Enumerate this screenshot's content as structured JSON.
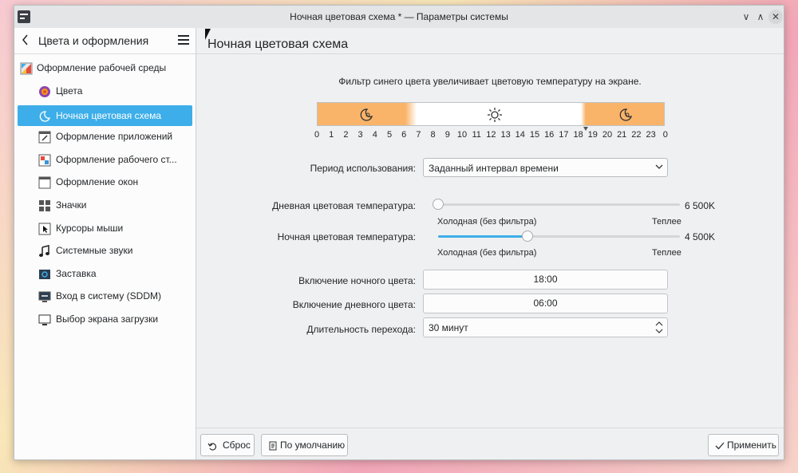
{
  "window": {
    "title": "Ночная цветовая схема * — Параметры системы",
    "controls": [
      "∨",
      "∧",
      "✕"
    ]
  },
  "sidebar": {
    "back_icon": "chevron-left-icon",
    "title": "Цвета и оформления",
    "menu_icon": "hamburger-icon",
    "top_item": {
      "label": "Оформление рабочей среды",
      "icon": "appearance-icon"
    },
    "items": [
      {
        "label": "Цвета",
        "icon": "colors-icon"
      },
      {
        "label": "Ночная цветовая схема",
        "icon": "night-color-icon",
        "active": true
      },
      {
        "label": "Оформление приложений",
        "icon": "app-style-icon"
      },
      {
        "label": "Оформление рабочего ст...",
        "icon": "plasma-style-icon"
      },
      {
        "label": "Оформление окон",
        "icon": "window-decoration-icon"
      },
      {
        "label": "Значки",
        "icon": "icons-icon"
      },
      {
        "label": "Курсоры мыши",
        "icon": "cursor-icon"
      },
      {
        "label": "Системные звуки",
        "icon": "music-note-icon"
      },
      {
        "label": "Заставка",
        "icon": "splash-screen-icon"
      },
      {
        "label": "Вход в систему (SDDM)",
        "icon": "login-screen-icon"
      },
      {
        "label": "Выбор экрана загрузки",
        "icon": "boot-screen-icon"
      }
    ]
  },
  "content": {
    "page_title": "Ночная цветовая схема",
    "description": "Фильтр синего цвета увеличивает цветовую температуру на экране.",
    "timeline": {
      "hours": [
        "0",
        "1",
        "2",
        "3",
        "4",
        "5",
        "6",
        "7",
        "8",
        "9",
        "10",
        "11",
        "12",
        "13",
        "14",
        "15",
        "16",
        "17",
        "18",
        "19",
        "20",
        "21",
        "22",
        "23",
        "0"
      ],
      "night_color": "#f9b46a",
      "day_color": "#ffffff",
      "current_hour": 17.6
    },
    "usage_period": {
      "label": "Период использования:",
      "value": "Заданный интервал времени"
    },
    "day_temp": {
      "label": "Дневная цветовая температура:",
      "value": "6 500K",
      "level": 0.0,
      "hint_left": "Холодная (без фильтра)",
      "hint_right": "Теплее"
    },
    "night_temp": {
      "label": "Ночная цветовая температура:",
      "value": "4 500K",
      "level": 0.37,
      "hint_left": "Холодная (без фильтра)",
      "hint_right": "Теплее"
    },
    "night_on": {
      "label": "Включение ночного цвета:",
      "value": "18:00"
    },
    "day_on": {
      "label": "Включение дневного цвета:",
      "value": "06:00"
    },
    "transition": {
      "label": "Длительность перехода:",
      "value": "30 минут"
    }
  },
  "footer": {
    "reset": "Сброс",
    "defaults": "По умолчанию",
    "apply": "Применить"
  },
  "colors": {
    "accent": "#3daee9"
  }
}
